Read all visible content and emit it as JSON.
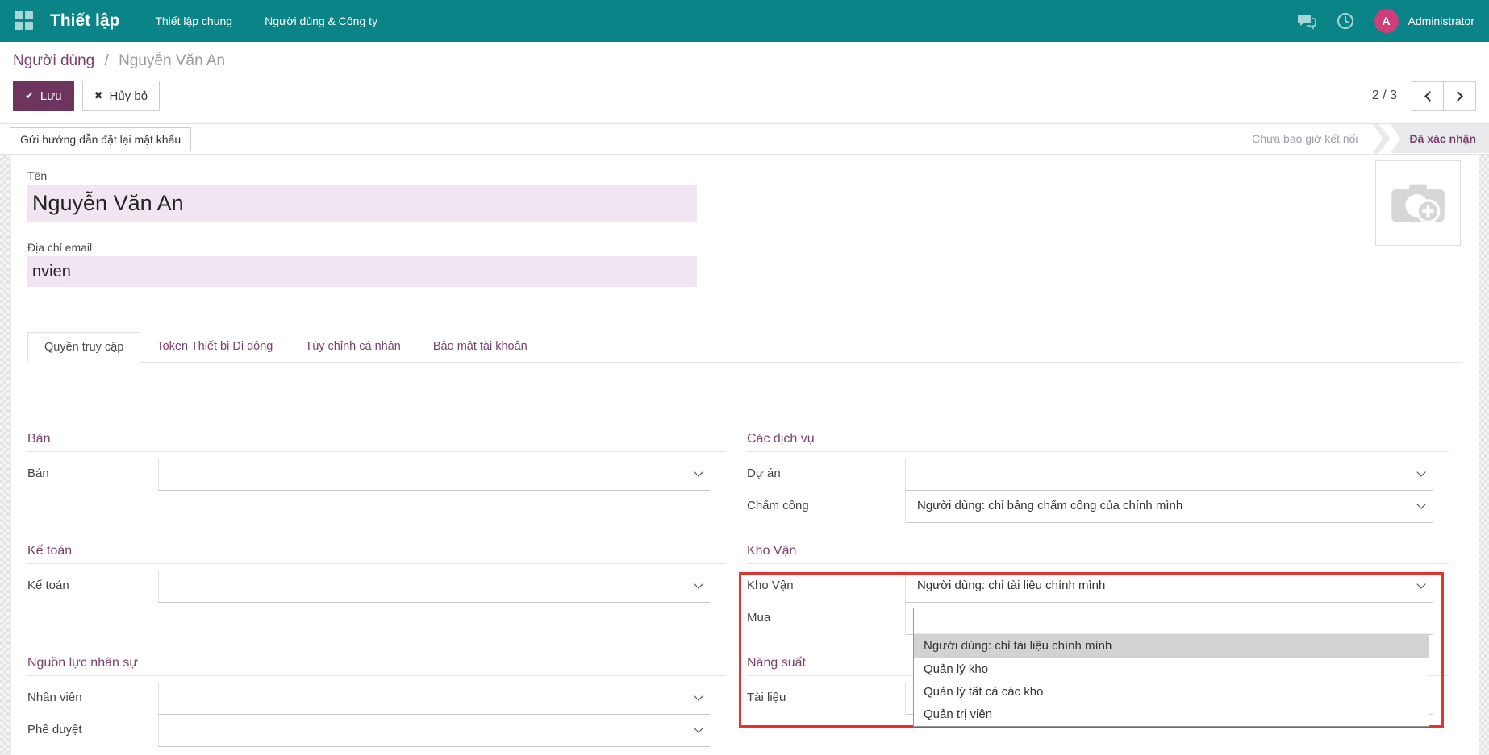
{
  "navbar": {
    "app_title": "Thiết lập",
    "menu_items": [
      {
        "label": "Thiết lập chung"
      },
      {
        "label": "Người dùng & Công ty"
      }
    ],
    "user": {
      "initial": "A",
      "name": "Administrator"
    }
  },
  "breadcrumb": {
    "parent": "Người dùng",
    "separator": "/",
    "current": "Nguyễn Văn An"
  },
  "control_panel": {
    "save_label": "Lưu",
    "discard_label": "Hủy bỏ",
    "pager_text": "2 / 3"
  },
  "action_bar": {
    "reset_password_label": "Gửi hướng dẫn đặt lại mật khẩu",
    "statusbar": [
      {
        "label": "Chưa bao giờ kết nối",
        "active": false
      },
      {
        "label": "Đã xác nhận",
        "active": true
      }
    ]
  },
  "form": {
    "name_field": {
      "label": "Tên",
      "value": "Nguyễn Văn An"
    },
    "email_field": {
      "label": "Địa chỉ email",
      "value": "nvien"
    },
    "tabs": [
      {
        "label": "Quyền truy cập",
        "active": true
      },
      {
        "label": "Token Thiết bị Di động",
        "active": false
      },
      {
        "label": "Tùy chỉnh cá nhân",
        "active": false
      },
      {
        "label": "Bảo mật tài khoản",
        "active": false
      }
    ],
    "left_sections": [
      {
        "title": "Bán",
        "fields": [
          {
            "label": "Bán",
            "value": ""
          }
        ]
      },
      {
        "title": "Kế toán",
        "fields": [
          {
            "label": "Kế toán",
            "value": ""
          }
        ]
      },
      {
        "title": "Nguồn lực nhân sự",
        "fields": [
          {
            "label": "Nhân viên",
            "value": ""
          },
          {
            "label": "Phê duyệt",
            "value": ""
          }
        ]
      }
    ],
    "right_sections": [
      {
        "title": "Các dịch vụ",
        "fields": [
          {
            "label": "Dự án",
            "value": ""
          },
          {
            "label": "Chấm công",
            "value": "Người dùng: chỉ bảng chấm công của chính mình"
          }
        ]
      },
      {
        "title": "Kho Vận",
        "fields": [
          {
            "label": "Kho Vận",
            "value": "Người dùng: chỉ tài liệu chính mình"
          },
          {
            "label": "Mua",
            "value": ""
          }
        ]
      },
      {
        "title": "Năng suất",
        "fields": [
          {
            "label": "Tài liệu",
            "value": ""
          }
        ]
      }
    ]
  },
  "kho_van_dropdown": {
    "options": [
      {
        "label": "",
        "selected": false
      },
      {
        "label": "Người dùng: chỉ tài liệu chính mình",
        "selected": true
      },
      {
        "label": "Quản lý kho",
        "selected": false
      },
      {
        "label": "Quản lý tất cả các kho",
        "selected": false
      },
      {
        "label": "Quản trị viên",
        "selected": false
      }
    ]
  },
  "colors": {
    "navbar_teal": "#0b8488",
    "primary_purple": "#6d345e",
    "heading_purple": "#7c3f6d",
    "avatar_pink": "#ce3e79",
    "highlight_red": "#e5332d",
    "input_lavender": "#f1e5f2"
  }
}
